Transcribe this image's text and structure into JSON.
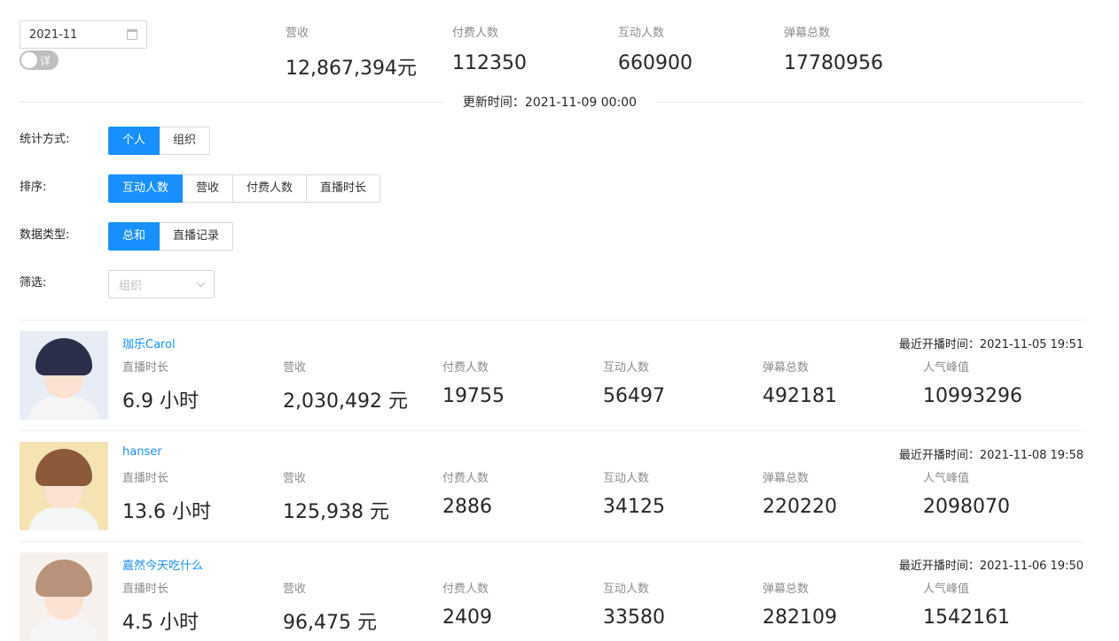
{
  "date_picker": {
    "value": "2021-11"
  },
  "toggle": {
    "label": "详",
    "on": false
  },
  "summary": [
    {
      "label": "营收",
      "value": "12,867,394",
      "unit": "元"
    },
    {
      "label": "付费人数",
      "value": "112350",
      "unit": ""
    },
    {
      "label": "互动人数",
      "value": "660900",
      "unit": ""
    },
    {
      "label": "弹幕总数",
      "value": "17780956",
      "unit": ""
    }
  ],
  "update_time": "更新时间：2021-11-09 00:00",
  "filters": {
    "stat_method": {
      "label": "统计方式:",
      "options": [
        "个人",
        "组织"
      ],
      "active": 0
    },
    "sort": {
      "label": "排序:",
      "options": [
        "互动人数",
        "营收",
        "付费人数",
        "直播时长"
      ],
      "active": 0
    },
    "data_type": {
      "label": "数据类型:",
      "options": [
        "总和",
        "直播记录"
      ],
      "active": 0
    },
    "filter": {
      "label": "筛选:",
      "placeholder": "组织"
    }
  },
  "stat_labels": [
    "直播时长",
    "营收",
    "付费人数",
    "互动人数",
    "弹幕总数",
    "人气峰值"
  ],
  "last_live_prefix": "最近开播时间：",
  "streamers": [
    {
      "name": "珈乐Carol",
      "last_live": "2021-11-05 19:51",
      "hair_color": "#2b2f4a",
      "bg_color": "#e8ecf5",
      "stats": [
        "6.9 小时",
        "2,030,492 元",
        "19755",
        "56497",
        "492181",
        "10993296"
      ]
    },
    {
      "name": "hanser",
      "last_live": "2021-11-08 19:58",
      "hair_color": "#8a5a3a",
      "bg_color": "#f6e3b4",
      "stats": [
        "13.6 小时",
        "125,938 元",
        "2886",
        "34125",
        "220220",
        "2098070"
      ]
    },
    {
      "name": "嘉然今天吃什么",
      "last_live": "2021-11-06 19:50",
      "hair_color": "#b8927a",
      "bg_color": "#f7f1ee",
      "stats": [
        "4.5 小时",
        "96,475 元",
        "2409",
        "33580",
        "282109",
        "1542161"
      ]
    }
  ]
}
